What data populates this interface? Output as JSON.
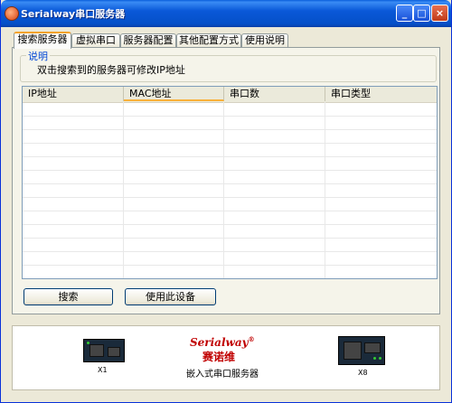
{
  "window": {
    "title": "Serialway串口服务器",
    "controls": {
      "minimize": "_",
      "maximize": "□",
      "close": "×"
    }
  },
  "tabs": [
    {
      "label": "搜索服务器",
      "active": true
    },
    {
      "label": "虚拟串口",
      "active": false
    },
    {
      "label": "服务器配置",
      "active": false
    },
    {
      "label": "其他配置方式",
      "active": false
    },
    {
      "label": "使用说明",
      "active": false
    }
  ],
  "description": {
    "title": "说明",
    "text": "双击搜索到的服务器可修改IP地址"
  },
  "table": {
    "columns": [
      "IP地址",
      "MAC地址",
      "串口数",
      "串口类型"
    ],
    "sorted_column": "MAC地址",
    "rows": []
  },
  "buttons": {
    "search": "搜索",
    "use_device": "使用此设备"
  },
  "footer": {
    "brand": "Serialway",
    "brand_mark": "®",
    "brand_cn": "赛诺维",
    "subtitle": "嵌入式串口服务器",
    "device_left": "X1",
    "device_right": "X8"
  },
  "colors": {
    "titlebar": "#0a58d8",
    "brand": "#c00000",
    "group_title": "#0046d5",
    "tab_highlight": "#f3a32c"
  }
}
